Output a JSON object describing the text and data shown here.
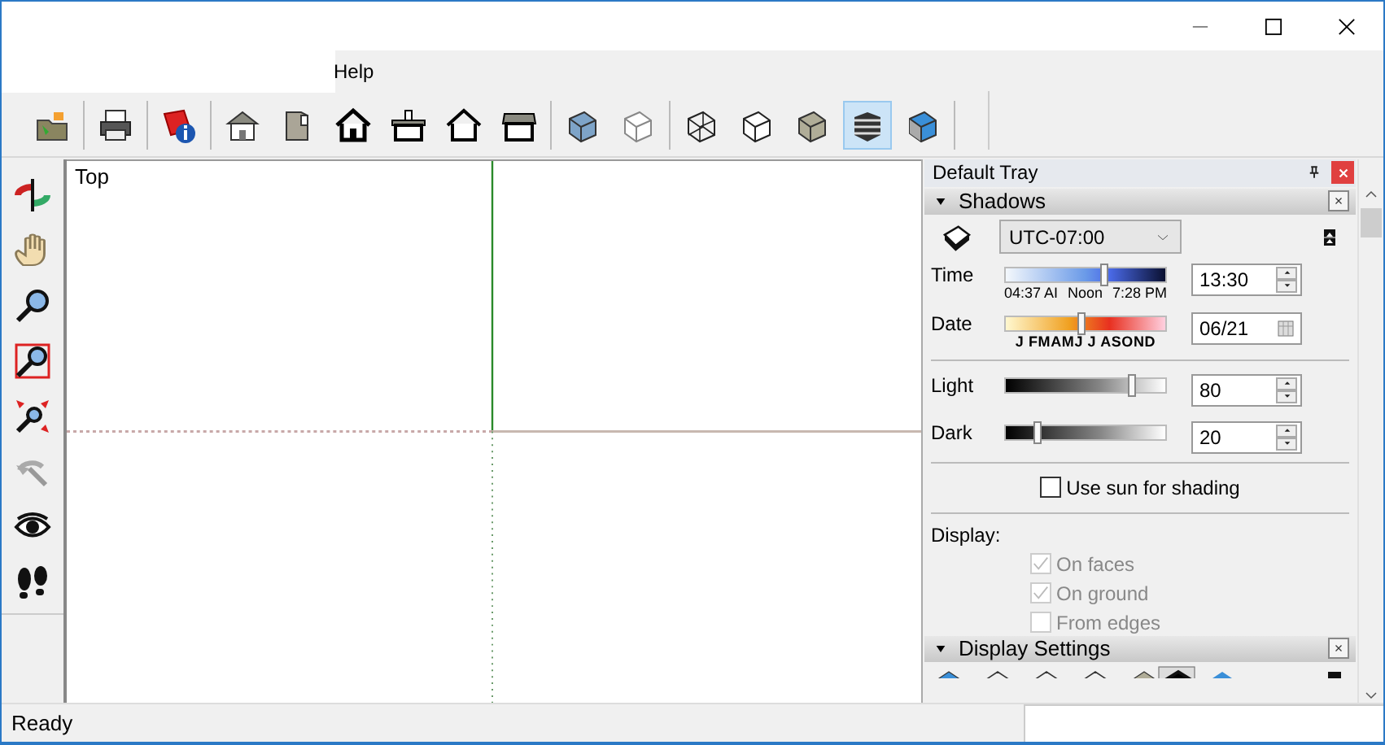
{
  "menu_bar": {
    "items": [
      "Help"
    ]
  },
  "toolbar": {
    "buttons": [
      {
        "selected": false
      },
      {
        "selected": false
      },
      {
        "selected": false
      },
      {
        "selected": false
      },
      {
        "selected": false
      },
      {
        "selected": false
      },
      {
        "selected": false
      },
      {
        "selected": false
      },
      {
        "selected": false
      },
      {
        "selected": false
      },
      {
        "selected": false
      },
      {
        "selected": false
      },
      {
        "selected": false
      },
      {
        "selected": false
      },
      {
        "selected": true
      },
      {
        "selected": false
      }
    ]
  },
  "viewport": {
    "label": "Top"
  },
  "tray": {
    "title": "Default Tray",
    "sections": [
      {
        "title": "Shadows",
        "expanded": true
      },
      {
        "title": "Display Settings",
        "expanded": true
      }
    ],
    "shadows": {
      "timezone": "UTC-07:00",
      "time": {
        "label": "Time",
        "level": 0.62,
        "ticks": [
          "04:37 AI",
          "Noon",
          "7:28 PM"
        ],
        "value": "13:30"
      },
      "date": {
        "label": "Date",
        "level": 0.48,
        "ticks": [
          "J FMAMJ J ASOND"
        ],
        "value": "06/21"
      },
      "light": {
        "label": "Light",
        "level": 0.8,
        "value": "80"
      },
      "dark": {
        "label": "Dark",
        "level": 0.2,
        "value": "20"
      },
      "use_sun": {
        "label": "Use sun for shading",
        "checked": false
      },
      "display_label": "Display:",
      "display": [
        {
          "label": "On faces",
          "checked": true,
          "disabled": true
        },
        {
          "label": "On ground",
          "checked": true,
          "disabled": true
        },
        {
          "label": "From edges",
          "checked": false,
          "disabled": true
        }
      ]
    }
  },
  "status_bar": {
    "text": "Ready"
  }
}
